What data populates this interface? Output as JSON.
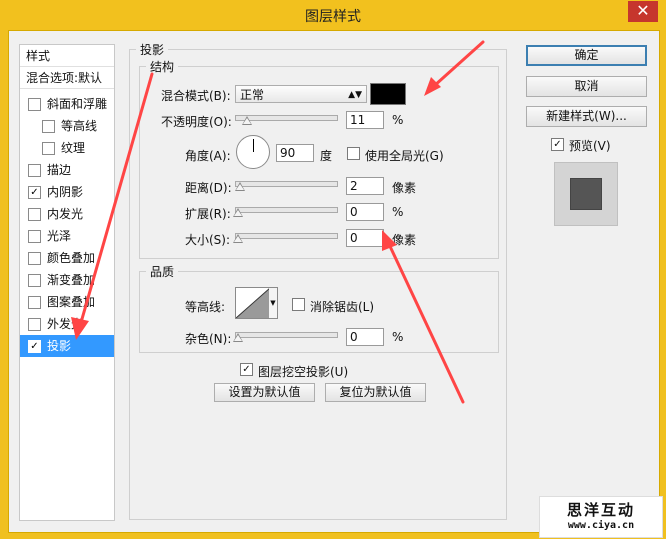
{
  "window": {
    "title": "图层样式",
    "close_glyph": "✕"
  },
  "sidebar": {
    "header_styles": "样式",
    "header_blending": "混合选项:默认",
    "items": [
      {
        "label": "斜面和浮雕",
        "checked": false
      },
      {
        "label": "等高线",
        "checked": false
      },
      {
        "label": "纹理",
        "checked": false
      },
      {
        "label": "描边",
        "checked": false
      },
      {
        "label": "内阴影",
        "checked": true
      },
      {
        "label": "内发光",
        "checked": false
      },
      {
        "label": "光泽",
        "checked": false
      },
      {
        "label": "颜色叠加",
        "checked": false
      },
      {
        "label": "渐变叠加",
        "checked": false
      },
      {
        "label": "图案叠加",
        "checked": false
      },
      {
        "label": "外发光",
        "checked": false
      },
      {
        "label": "投影",
        "checked": true
      }
    ]
  },
  "drop_shadow": {
    "group_title": "投影",
    "structure": {
      "title": "结构",
      "blend_mode_label": "混合模式(B):",
      "blend_mode_value": "正常",
      "shadow_color": "#000000",
      "opacity_label": "不透明度(O):",
      "opacity_value": "11",
      "opacity_unit": "%",
      "angle_label": "角度(A):",
      "angle_value": "90",
      "angle_unit": "度",
      "global_light_label": "使用全局光(G)",
      "global_light_checked": false,
      "distance_label": "距离(D):",
      "distance_value": "2",
      "distance_unit": "像素",
      "spread_label": "扩展(R):",
      "spread_value": "0",
      "spread_unit": "%",
      "size_label": "大小(S):",
      "size_value": "0",
      "size_unit": "像素"
    },
    "quality": {
      "title": "品质",
      "contour_label": "等高线:",
      "anti_alias_label": "消除锯齿(L)",
      "anti_alias_checked": false,
      "noise_label": "杂色(N):",
      "noise_value": "0",
      "noise_unit": "%"
    },
    "knockout_label": "图层挖空投影(U)",
    "knockout_checked": true,
    "make_default_label": "设置为默认值",
    "reset_default_label": "复位为默认值"
  },
  "right_panel": {
    "ok_label": "确定",
    "cancel_label": "取消",
    "new_style_label": "新建样式(W)...",
    "preview_label": "预览(V)",
    "preview_checked": true
  },
  "watermark": {
    "brand": "思洋互动",
    "url": "www.ciya.cn"
  },
  "colors": {
    "title_bar": "#f2c11e",
    "selection": "#3399ff",
    "annotation_arrows": "#ff4545"
  }
}
